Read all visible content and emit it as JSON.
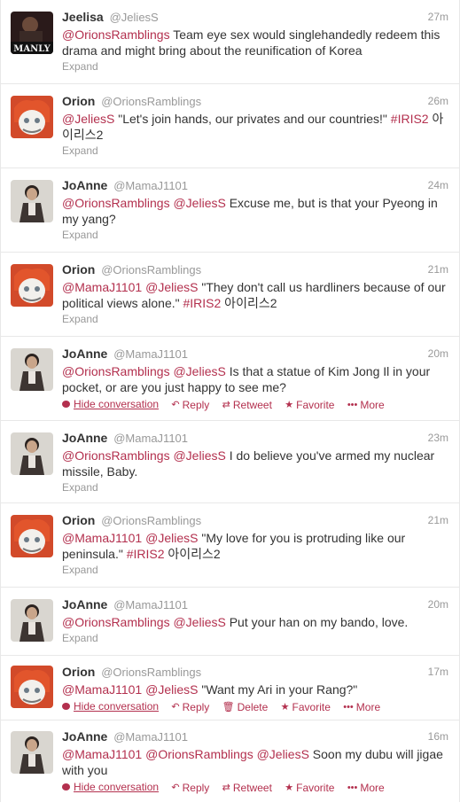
{
  "expand_label": "Expand",
  "actions": {
    "hide_conversation": "Hide conversation",
    "reply": "Reply",
    "retweet": "Retweet",
    "delete": "Delete",
    "favorite": "Favorite",
    "more": "More"
  },
  "avatar_text": {
    "jeelisa": "MANLY"
  },
  "colors": {
    "link": "#b3304e",
    "muted": "#999999",
    "text": "#333333"
  },
  "tweets": [
    {
      "fullname": "Jeelisa",
      "username": "@JeliesS",
      "time": "27m",
      "mentions": "@OrionsRamblings",
      "body": " Team eye sex would singlehandedly redeem this drama and might bring about the reunification of Korea",
      "hashtag": "",
      "tail": ""
    },
    {
      "fullname": "Orion",
      "username": "@OrionsRamblings",
      "time": "26m",
      "mentions": "@JeliesS",
      "body": " \"Let's join hands, our privates and our countries!\" ",
      "hashtag": "#IRIS2",
      "tail": " 아이리스2"
    },
    {
      "fullname": "JoAnne",
      "username": "@MamaJ1101",
      "time": "24m",
      "mentions": "@OrionsRamblings @JeliesS",
      "body": " Excuse me, but is that your Pyeong in my yang?",
      "hashtag": "",
      "tail": ""
    },
    {
      "fullname": "Orion",
      "username": "@OrionsRamblings",
      "time": "21m",
      "mentions": "@MamaJ1101 @JeliesS",
      "body": " \"They don't call us hardliners because of our political views alone.\" ",
      "hashtag": "#IRIS2",
      "tail": " 아이리스2"
    },
    {
      "fullname": "JoAnne",
      "username": "@MamaJ1101",
      "time": "20m",
      "mentions": "@OrionsRamblings @JeliesS",
      "body": " Is that a statue of Kim Jong Il in your pocket, or are you just happy to see me?",
      "hashtag": "",
      "tail": ""
    },
    {
      "fullname": "JoAnne",
      "username": "@MamaJ1101",
      "time": "23m",
      "mentions": "@OrionsRamblings @JeliesS",
      "body": " I do believe you've armed my nuclear missile, Baby.",
      "hashtag": "",
      "tail": ""
    },
    {
      "fullname": "Orion",
      "username": "@OrionsRamblings",
      "time": "21m",
      "mentions": "@MamaJ1101 @JeliesS",
      "body": " \"My love for you is protruding like our peninsula.\" ",
      "hashtag": "#IRIS2",
      "tail": " 아이리스2"
    },
    {
      "fullname": "JoAnne",
      "username": "@MamaJ1101",
      "time": "20m",
      "mentions": "@OrionsRamblings @JeliesS",
      "body": " Put your han on my bando, love.",
      "hashtag": "",
      "tail": ""
    },
    {
      "fullname": "Orion",
      "username": "@OrionsRamblings",
      "time": "17m",
      "mentions": "@MamaJ1101 @JeliesS",
      "body": " \"Want my Ari in your Rang?\"",
      "hashtag": "",
      "tail": ""
    },
    {
      "fullname": "JoAnne",
      "username": "@MamaJ1101",
      "time": "16m",
      "mentions": "@MamaJ1101 @OrionsRamblings @JeliesS",
      "body": " Soon my dubu will jigae with you",
      "hashtag": "",
      "tail": ""
    }
  ]
}
